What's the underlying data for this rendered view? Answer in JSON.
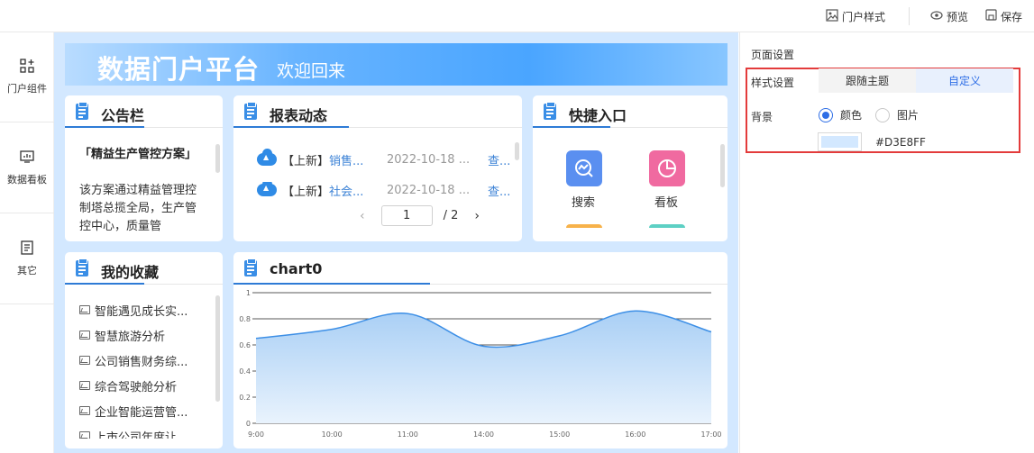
{
  "topbar": {
    "portal_style": "门户样式",
    "preview": "预览",
    "save": "保存"
  },
  "sidebar": {
    "items": [
      {
        "label": "门户组件",
        "icon": "components-icon"
      },
      {
        "label": "数据看板",
        "icon": "dashboard-icon"
      },
      {
        "label": "其它",
        "icon": "document-icon"
      }
    ]
  },
  "banner": {
    "title": "数据门户平台",
    "subtitle": "欢迎回来"
  },
  "notice": {
    "title": "公告栏",
    "item_title": "「精益生产管控方案」",
    "item_body": "该方案通过精益管理控制塔总揽全局，生产管控中心，质量管"
  },
  "reports": {
    "title": "报表动态",
    "rows": [
      {
        "tag": "【上新】",
        "name": "销售...",
        "date": "2022-10-18 ...",
        "action": "查..."
      },
      {
        "tag": "【上新】",
        "name": "社会...",
        "date": "2022-10-18 ...",
        "action": "查..."
      }
    ],
    "page": "1",
    "total": "/ 2"
  },
  "quick": {
    "title": "快捷入口",
    "items": [
      {
        "label": "搜索",
        "icon": "search-chart-icon",
        "color": "#5a8ff0"
      },
      {
        "label": "看板",
        "icon": "pie-chart-icon",
        "color": "#f06aa0"
      }
    ]
  },
  "favorites": {
    "title": "我的收藏",
    "items": [
      "智能遇见成长实...",
      "智慧旅游分析",
      "公司销售财务综...",
      "综合驾驶舱分析",
      "企业智能运营管...",
      "上市公司年度让..."
    ]
  },
  "chart": {
    "title": "chart0"
  },
  "chart_data": {
    "type": "area",
    "title": "chart0",
    "x": [
      "9:00",
      "10:00",
      "11:00",
      "14:00",
      "15:00",
      "16:00",
      "17:00"
    ],
    "values": [
      0.65,
      0.72,
      0.84,
      0.59,
      0.67,
      0.86,
      0.7
    ],
    "yticks": [
      "0",
      "0.2",
      "0.4",
      "0.6",
      "0.8",
      "1"
    ],
    "ylim": [
      0,
      1
    ],
    "grid": true,
    "line_color": "#3d8fe6"
  },
  "right_panel": {
    "title": "页面设置",
    "style_label": "样式设置",
    "seg_follow": "跟随主题",
    "seg_custom": "自定义",
    "bg_label": "背景",
    "radio_color": "颜色",
    "radio_image": "图片",
    "color_hex": "#D3E8FF",
    "accent": "#2e6ee6"
  }
}
